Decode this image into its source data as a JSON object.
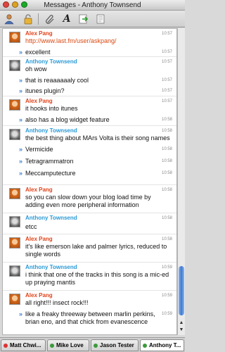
{
  "window": {
    "title": "Messages - Anthony Townsend"
  },
  "toolbar": {
    "icons": [
      "person-icon",
      "lock-icon",
      "attach-icon",
      "font-icon",
      "send-file-icon",
      "info-icon"
    ]
  },
  "colors": {
    "alex": "#e0431a",
    "anthony": "#2a9ad6",
    "continuation_arrow": "#3b7fd0"
  },
  "messages": [
    {
      "sender": "Alex Pang",
      "lines": [
        {
          "time": "10:57",
          "text": "http://www.last.fm/user/askpang/"
        },
        {
          "time": "10:57",
          "text": "excellent"
        }
      ]
    },
    {
      "sender": "Anthony Townsend",
      "lines": [
        {
          "time": "10:57",
          "text": "oh wow"
        },
        {
          "time": "10:57",
          "text": "that is reaaaaaaly cool"
        },
        {
          "time": "10:57",
          "text": "itunes plugin?"
        }
      ]
    },
    {
      "sender": "Alex Pang",
      "lines": [
        {
          "time": "10:57",
          "text": "it hooks into itunes"
        },
        {
          "time": "10:58",
          "text": "also has a blog widget feature"
        }
      ]
    },
    {
      "sender": "Anthony Townsend",
      "lines": [
        {
          "time": "10:58",
          "text": "the best thing about MArs Volta is their song names"
        },
        {
          "time": "10:58",
          "text": "Vermicide"
        },
        {
          "time": "10:58",
          "text": "Tetragrammatron"
        },
        {
          "time": "10:58",
          "text": "Meccamputecture"
        }
      ]
    },
    {
      "sender": "Alex Pang",
      "lines": [
        {
          "time": "10:58",
          "text": "so you can slow down your blog load time by adding even more peripheral information"
        }
      ]
    },
    {
      "sender": "Anthony Townsend",
      "lines": [
        {
          "time": "10:58",
          "text": "etcc"
        }
      ]
    },
    {
      "sender": "Alex Pang",
      "lines": [
        {
          "time": "10:58",
          "text": "it's like emerson lake and palmer lyrics, reduced to single words"
        }
      ]
    },
    {
      "sender": "Anthony Townsend",
      "lines": [
        {
          "time": "10:59",
          "text": "i think that one of the tracks in this song is a mic-ed up praying mantis"
        }
      ]
    },
    {
      "sender": "Alex Pang",
      "lines": [
        {
          "time": "10:59",
          "text": "all right!!! insect rock!!!"
        },
        {
          "time": "10:59",
          "text": "like a freaky threeway between marlin perkins, brian eno, and that chick from evanescence"
        }
      ]
    }
  ],
  "tabs": [
    {
      "label": "Matt Chwi...",
      "active": false
    },
    {
      "label": "Mike Love",
      "active": false
    },
    {
      "label": "Jason Tester",
      "active": false
    },
    {
      "label": "Anthony T...",
      "active": true
    }
  ]
}
